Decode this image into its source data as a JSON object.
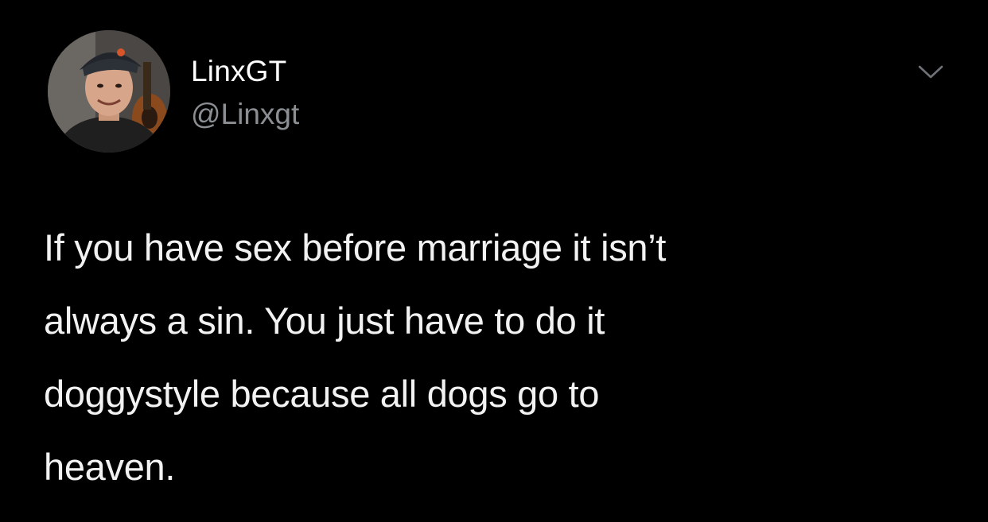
{
  "user": {
    "display_name": "LinxGT",
    "handle": "@Linxgt",
    "avatar_icon": "profile-photo"
  },
  "tweet": {
    "text": "If you have sex before marriage it isn’t\nalways a sin. You just have to do it\ndoggystyle because all dogs go to\nheaven."
  },
  "menu": {
    "icon": "chevron-down-icon"
  },
  "colors": {
    "background": "#000000",
    "text": "#f2f2f2",
    "secondary_text": "#8b8f93"
  }
}
